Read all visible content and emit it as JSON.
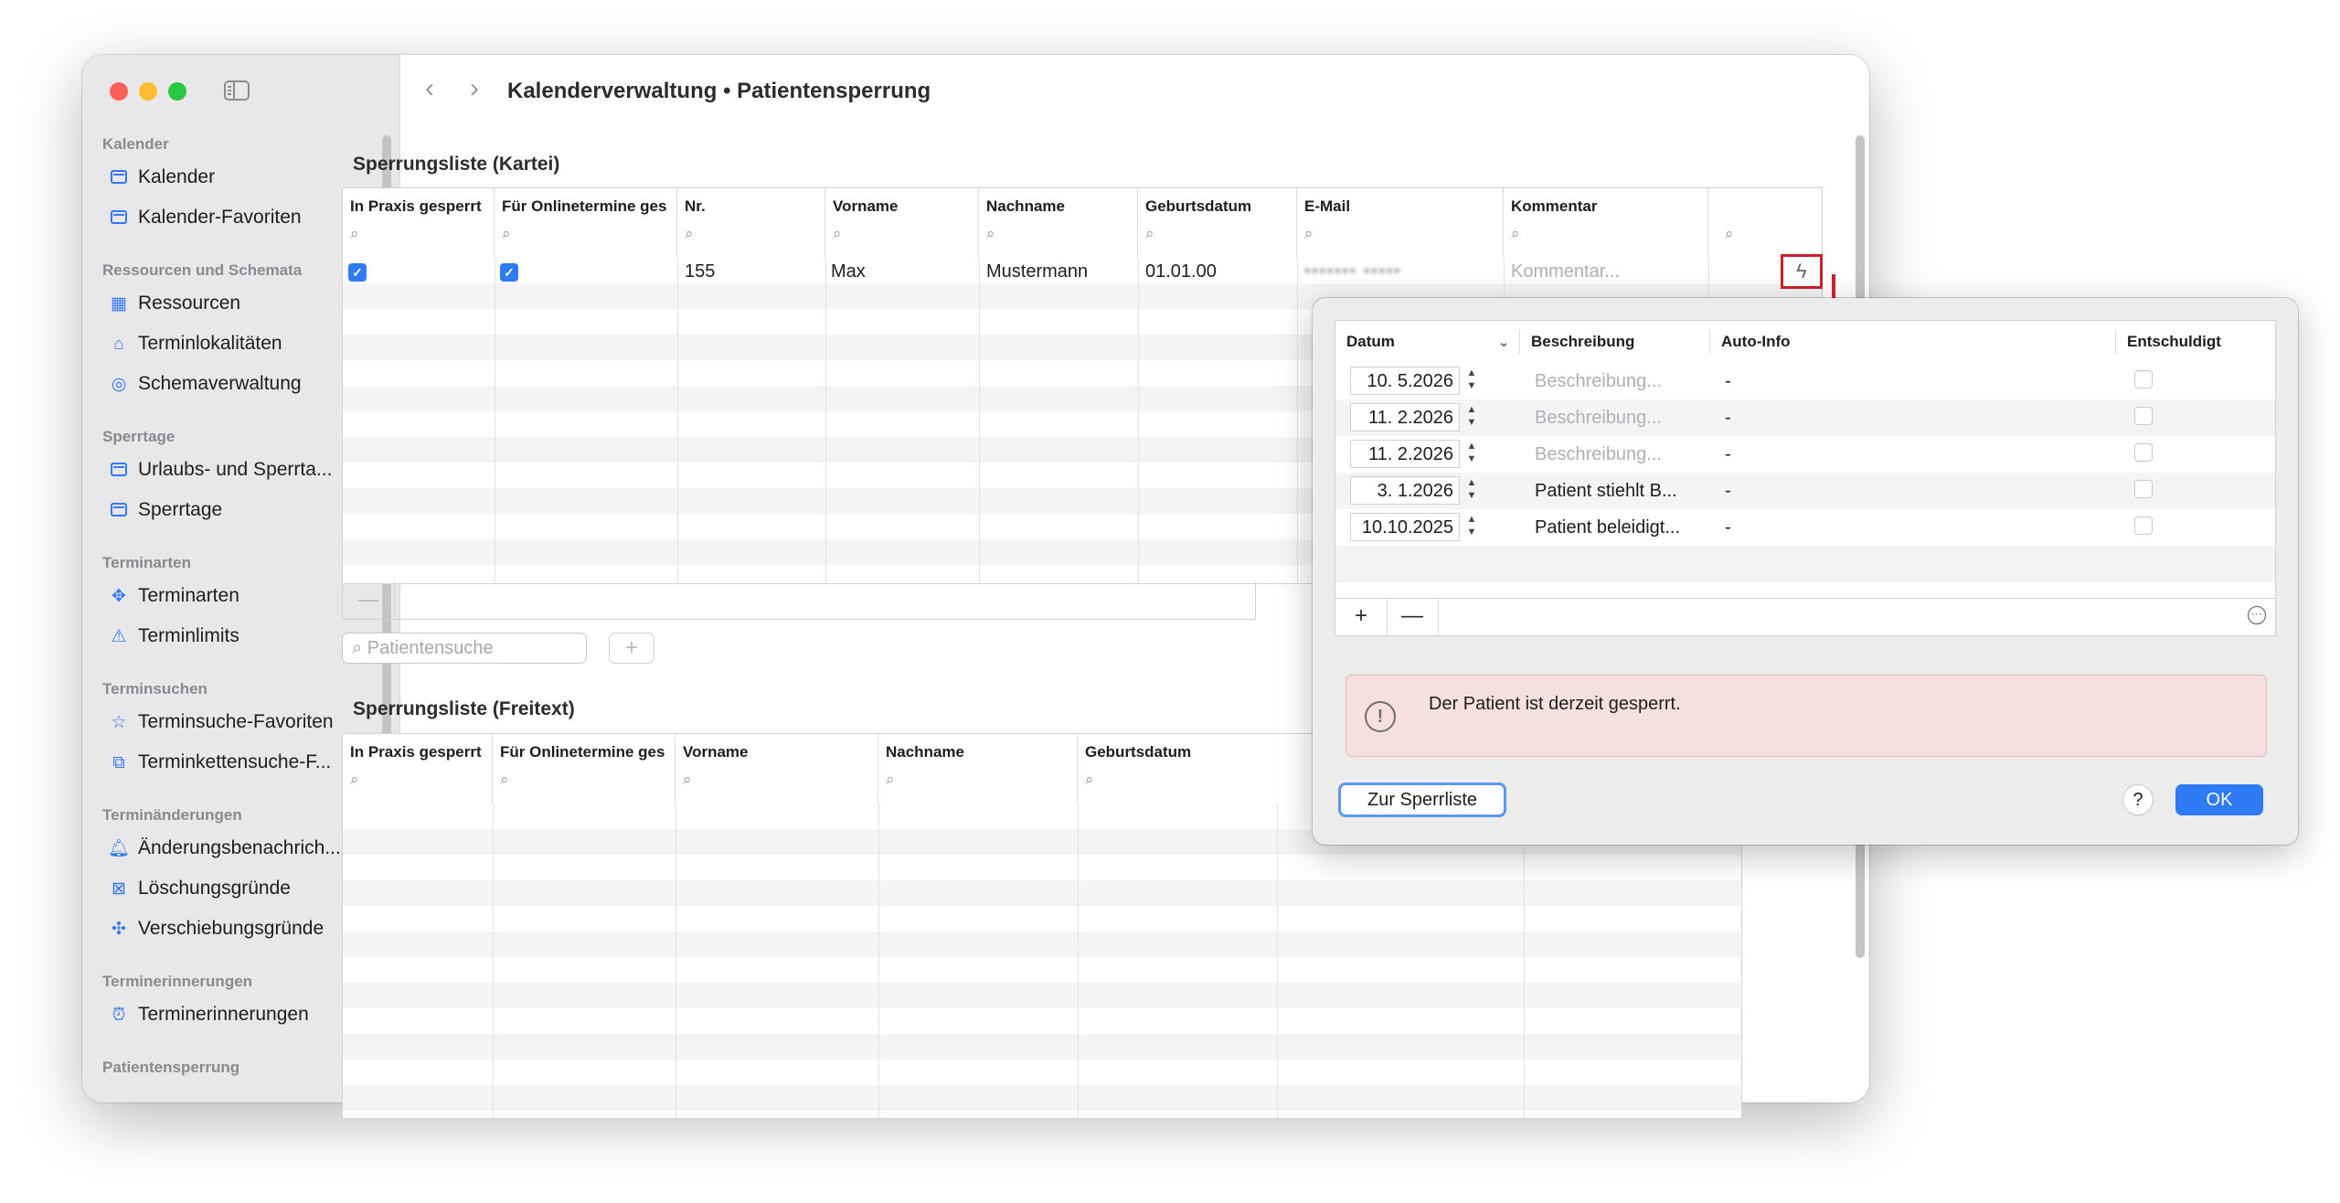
{
  "window": {
    "title": "Kalenderverwaltung • Patientensperrung"
  },
  "sidebar": {
    "sections": [
      {
        "title": "Kalender",
        "items": [
          {
            "label": "Kalender",
            "icon": "calendar-icon"
          },
          {
            "label": "Kalender-Favoriten",
            "icon": "calendar-icon"
          }
        ]
      },
      {
        "title": "Ressourcen und Schemata",
        "items": [
          {
            "label": "Ressourcen",
            "icon": "grid-icon"
          },
          {
            "label": "Terminlokalitäten",
            "icon": "house-icon"
          },
          {
            "label": "Schemaverwaltung",
            "icon": "stack-icon"
          }
        ]
      },
      {
        "title": "Sperrtage",
        "items": [
          {
            "label": "Urlaubs- und Sperrta...",
            "icon": "calendar-badge-icon"
          },
          {
            "label": "Sperrtage",
            "icon": "calendar-badge-icon"
          }
        ]
      },
      {
        "title": "Terminarten",
        "items": [
          {
            "label": "Terminarten",
            "icon": "shapes-icon"
          },
          {
            "label": "Terminlimits",
            "icon": "warning-icon"
          }
        ]
      },
      {
        "title": "Terminsuchen",
        "items": [
          {
            "label": "Terminsuche-Favoriten",
            "icon": "star-icon"
          },
          {
            "label": "Terminkettensuche-F...",
            "icon": "chain-icon"
          }
        ]
      },
      {
        "title": "Terminänderungen",
        "items": [
          {
            "label": "Änderungsbenachrich...",
            "icon": "bell-icon"
          },
          {
            "label": "Löschungsgründe",
            "icon": "trash-icon"
          },
          {
            "label": "Verschiebungsgründe",
            "icon": "move-icon"
          }
        ]
      },
      {
        "title": "Terminerinnerungen",
        "items": [
          {
            "label": "Terminerinnerungen",
            "icon": "alarm-icon"
          }
        ]
      },
      {
        "title": "Patientensperrung",
        "items": []
      }
    ]
  },
  "kartei": {
    "title": "Sperrungsliste (Kartei)",
    "columns": [
      "In Praxis gesperrt",
      "Für Onlinetermine ges",
      "Nr.",
      "Vorname",
      "Nachname",
      "Geburtsdatum",
      "E-Mail",
      "Kommentar"
    ],
    "row": {
      "praxis": true,
      "online": true,
      "nr": "155",
      "vorname": "Max",
      "nachname": "Mustermann",
      "geburtsdatum": "01.01.00",
      "email": "••••••• •••••",
      "kommentar_placeholder": "Kommentar..."
    },
    "minus_label": "—",
    "search_placeholder": "Patientensuche",
    "plus_label": "+"
  },
  "freitext": {
    "title": "Sperrungsliste (Freitext)",
    "columns": [
      "In Praxis gesperrt",
      "Für Onlinetermine ges",
      "Vorname",
      "Nachname",
      "Geburtsdatum"
    ]
  },
  "popover": {
    "columns": [
      "Datum",
      "Beschreibung",
      "Auto-Info",
      "Entschuldigt"
    ],
    "rows": [
      {
        "date": "10.  5.2026",
        "desc": "",
        "auto": "-"
      },
      {
        "date": "11.  2.2026",
        "desc": "",
        "auto": "-"
      },
      {
        "date": "11.  2.2026",
        "desc": "",
        "auto": "-"
      },
      {
        "date": "3.  1.2026",
        "desc": "Patient stiehlt B...",
        "auto": "-"
      },
      {
        "date": "10.10.2025",
        "desc": "Patient beleidigt...",
        "auto": "-"
      }
    ],
    "desc_placeholder": "Beschreibung...",
    "plus_label": "+",
    "minus_label": "—",
    "alert_text": "Der Patient ist derzeit gesperrt.",
    "btn_sperrliste": "Zur Sperrliste",
    "btn_help": "?",
    "btn_ok": "OK"
  },
  "colors": {
    "accent": "#2f7bf5",
    "highlight": "#cc1f28",
    "alert_bg": "#f6dfe0"
  }
}
